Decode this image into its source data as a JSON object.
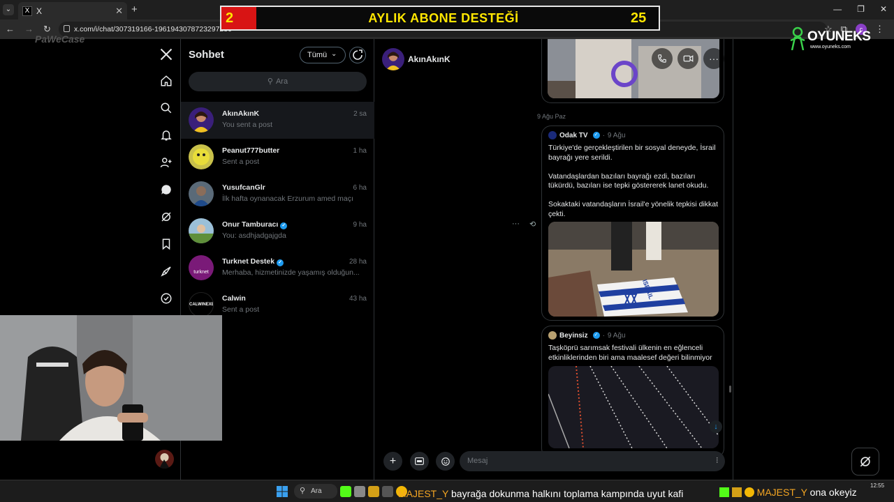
{
  "browser": {
    "tab_title": "X",
    "tab_favicon": "X",
    "url": "x.com/i/chat/307319166-1961943078723297280",
    "profile_letter": "c"
  },
  "banner": {
    "left_number": "2",
    "title": "AYLIK ABONE DESTEĞİ",
    "right_number": "25"
  },
  "brand": {
    "name": "OYUNEKS",
    "url": "www.oyuneks.com",
    "left_logo": "PaWeCase"
  },
  "chat": {
    "title": "Sohbet",
    "filter_label": "Tümü",
    "search_placeholder": "Ara",
    "conversations": [
      {
        "name": "AkınAkınK",
        "preview": "You sent a post",
        "time": "2 sa",
        "verified": false,
        "active": true
      },
      {
        "name": "Peanut777butter",
        "preview": "Sent a post",
        "time": "1 ha",
        "verified": false
      },
      {
        "name": "YusufcanGlr",
        "preview": "İlk hafta oynanacak Erzurum amed maçı",
        "time": "6 ha",
        "verified": false
      },
      {
        "name": "Onur Tamburacı",
        "preview": "You: asdhjadgajgda",
        "time": "9 ha",
        "verified": true
      },
      {
        "name": "Turknet Destek",
        "preview": "Merhaba, hizmetinizde yaşamış olduğun...",
        "time": "28 ha",
        "verified": true
      },
      {
        "name": "Calwin",
        "preview": "Sent a post",
        "time": "43 ha",
        "verified": false
      }
    ],
    "calwin_avatar_text": "CALWINEXE",
    "turknet_avatar_text": "turknet"
  },
  "conversation": {
    "name": "AkınAkınK",
    "date_separator": "9 Ağu Paz",
    "posts": [
      {
        "author": "Odak TV",
        "date": "9 Ağu",
        "verified": true,
        "paragraphs": [
          "Türkiye'de gerçekleştirilen bir sosyal deneyde, İsrail bayrağı yere serildi.",
          "Vatandaşlardan bazıları bayrağı ezdi, bazıları tükürdü, bazıları ise tepki göstererek lanet okudu.",
          "Sokaktaki vatandaşların İsrail'e yönelik tepkisi dikkat çekti."
        ],
        "flag_text": "ISRAIL"
      },
      {
        "author": "Beyinsiz",
        "date": "9 Ağu",
        "verified": true,
        "paragraphs": [
          "Taşköprü sarımsak festivali ülkenin en eğlenceli etkinliklerinden biri ama maalesef değeri bilinmiyor"
        ]
      }
    ],
    "composer_placeholder": "Mesaj"
  },
  "taskbar": {
    "search_label": "Ara",
    "time": "12:55",
    "ticker_user": "MAJEST_Y",
    "ticker_text": "bayrağa dokunma halkını toplama kampında uyut kafi",
    "ticker_user2": "MAJEST_Y",
    "ticker_text2": "ona okeyiz"
  },
  "colors": {
    "accent": "#1d9bf0",
    "background": "#000000",
    "banner_yellow": "#ffe600",
    "banner_red": "#d81414"
  }
}
